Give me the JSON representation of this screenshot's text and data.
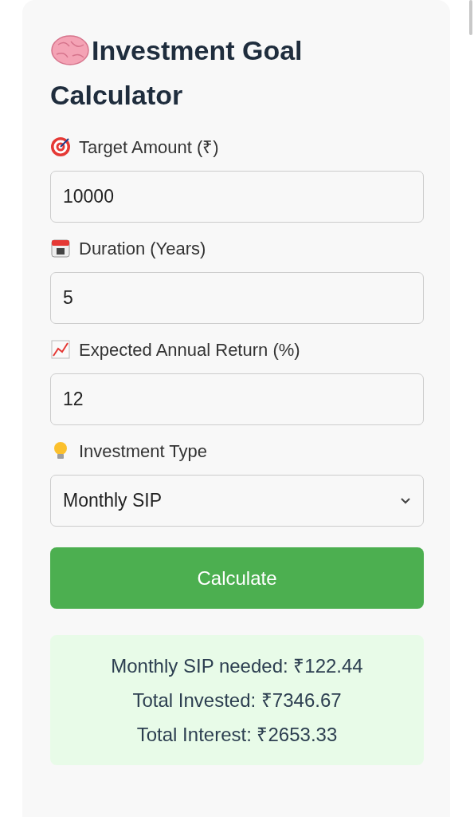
{
  "title": {
    "line1": "Investment Goal",
    "line2": "Calculator"
  },
  "fields": [
    {
      "kind": "input",
      "label": "Target Amount (₹)",
      "value": "10000"
    },
    {
      "kind": "input",
      "label": "Duration (Years)",
      "value": "5"
    },
    {
      "kind": "input",
      "label": "Expected Annual Return (%)",
      "value": "12"
    },
    {
      "kind": "select",
      "label": "Investment Type",
      "value": "Monthly SIP"
    }
  ],
  "button": "Calculate",
  "results": [
    "Monthly SIP needed: ₹122.44",
    "Total Invested: ₹7346.67",
    "Total Interest: ₹2653.33"
  ]
}
